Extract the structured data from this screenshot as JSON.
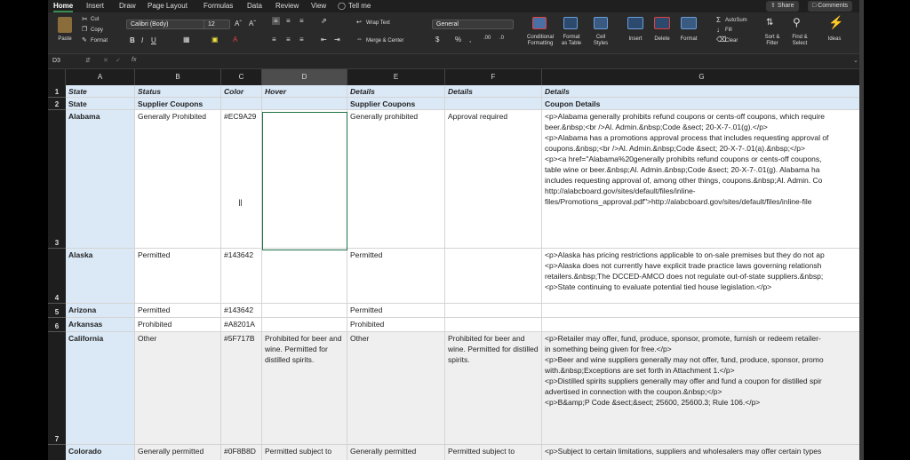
{
  "menu": {
    "items": [
      "Home",
      "Insert",
      "Draw",
      "Page Layout",
      "Formulas",
      "Data",
      "Review",
      "View"
    ],
    "tell_me": "Tell me",
    "share": "Share",
    "comments": "Comments"
  },
  "ribbon": {
    "paste": "Paste",
    "cut": "Cut",
    "copy": "Copy",
    "format": "Format",
    "font_name": "Calibri (Body)",
    "font_size": "12",
    "wrap_text": "Wrap Text",
    "merge_center": "Merge & Center",
    "number_format": "General",
    "conditional_formatting": [
      "Conditional",
      "Formatting"
    ],
    "format_as_table": [
      "Format",
      "as Table"
    ],
    "cell_styles": [
      "Cell",
      "Styles"
    ],
    "insert": "Insert",
    "delete": "Delete",
    "format_cells": "Format",
    "autosum": "AutoSum",
    "fill": "Fill",
    "clear": "Clear",
    "sort_filter": [
      "Sort &",
      "Filter"
    ],
    "find_select": [
      "Find &",
      "Select"
    ],
    "ideas": "Ideas"
  },
  "formula_bar": {
    "cell_ref": "D3",
    "fx": "fx",
    "value": ""
  },
  "grid": {
    "columns": [
      "A",
      "B",
      "C",
      "D",
      "E",
      "F",
      "G"
    ],
    "selected_column": "D",
    "rows": [
      {
        "num": "1",
        "cells": [
          "State",
          "Status",
          "Color",
          "Hover",
          "Details",
          "Details",
          "Details"
        ]
      },
      {
        "num": "2",
        "cells": [
          "State",
          "Supplier Coupons",
          "",
          "",
          "Supplier Coupons",
          "",
          "Coupon Details"
        ]
      },
      {
        "num": "3",
        "cells": [
          "Alabama",
          "Generally Prohibited",
          "#EC9A29",
          "",
          "Generally prohibited",
          "Approval required",
          [
            "<p>Alabama generally prohibits refund coupons or cents-off coupons, which require",
            "beer.&nbsp;<br />Al. Admin.&nbsp;Code &sect; 20-X-7-.01(g).</p>",
            "<p>Alabama has a promotions approval process that includes requesting approval of",
            "coupons.&nbsp;<br />Al. Admin.&nbsp;Code &sect; 20-X-7-.01(a).&nbsp;</p>",
            "<p><a href=\"Alabama%20generally prohibits refund coupons or cents-off coupons,",
            "table wine or beer.&nbsp;Al. Admin.&nbsp;Code &sect; 20-X-7-.01(g).  Alabama ha",
            "includes requesting approval of, among other things, coupons.&nbsp;Al. Admin. Co",
            "http://alabcboard.gov/sites/default/files/inline-",
            "files/Promotions_approval.pdf\">http://alabcboard.gov/sites/default/files/inline-file"
          ]
        ]
      },
      {
        "num": "4",
        "cells": [
          "Alaska",
          "Permitted",
          "#143642",
          "",
          "Permitted",
          "",
          [
            "<p>Alaska has pricing restrictions applicable to on-sale premises but they do not ap",
            "<p>Alaska does not currently have explicit trade practice laws governing relationsh",
            "retailers.&nbsp;The DCCED-AMCO does not regulate out-of-state suppliers.&nbsp;",
            "<p>State continuing to evaluate potential tied house legislation.</p>"
          ]
        ]
      },
      {
        "num": "5",
        "cells": [
          "Arizona",
          "Permitted",
          "#143642",
          "",
          "Permitted",
          "",
          ""
        ]
      },
      {
        "num": "6",
        "cells": [
          "Arkansas",
          "Prohibited",
          "#A8201A",
          "",
          "Prohibited",
          "",
          ""
        ]
      },
      {
        "num": "7",
        "cells": [
          "California",
          "Other",
          "#5F717B",
          "Prohibited for beer and wine.  Permitted for distilled spirits.",
          "Other",
          "Prohibited for beer and wine.  Permitted for distilled spirits.",
          [
            "<p>Retailer may offer, fund, produce, sponsor, promote, furnish or redeem retailer-",
            "in something being given for free.</p>",
            "<p>Beer and wine suppliers generally may not offer, fund, produce, sponsor, promo",
            "with.&nbsp;Exceptions are set forth in Attachment 1.</p>",
            "<p>Distilled spirits suppliers generally may offer and fund a coupon for distilled spir",
            "advertised in connection with the coupon.&nbsp;</p>",
            "<p>B&amp;P Code &sect;&sect; 25600, 25600.3; Rule 106.</p>"
          ]
        ]
      },
      {
        "num": "",
        "cells": [
          "Colorado",
          "Generally permitted",
          "#0F8B8D",
          "Permitted subject to",
          "Generally permitted",
          "Permitted subject to",
          [
            "<p>Subject to certain limitations, suppliers and wholesalers may offer certain types"
          ]
        ]
      }
    ]
  },
  "colors": {
    "accent_green": "#3c8d4f",
    "header_row_blue": "#dbe9f7",
    "col_a_blue": "#dbe9f7",
    "selection_green": "#1e7145"
  }
}
